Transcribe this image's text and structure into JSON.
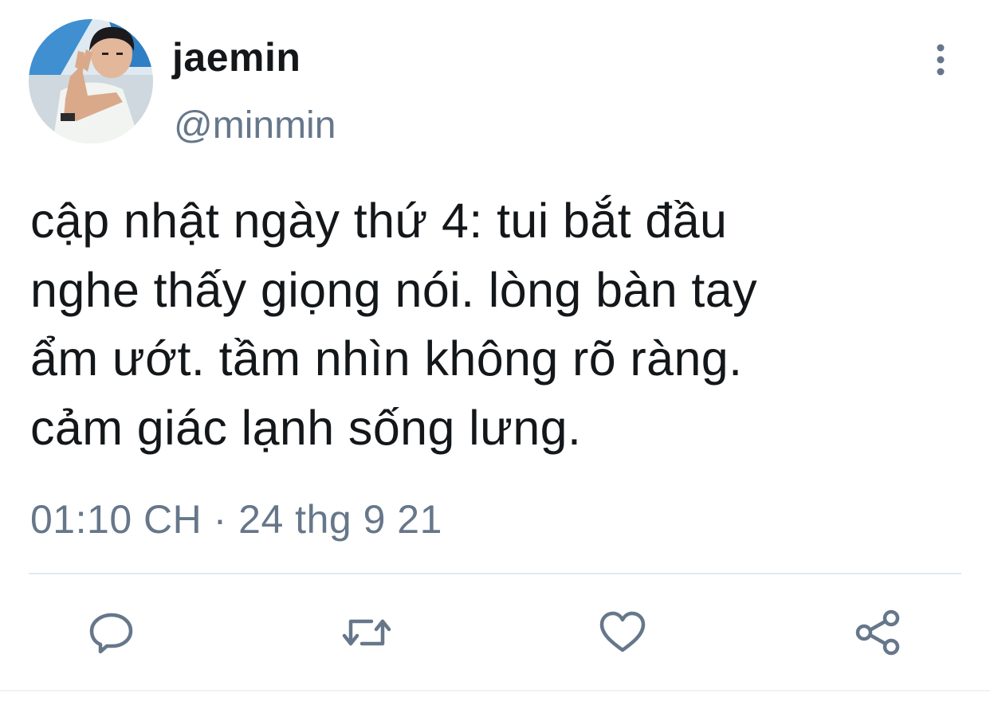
{
  "user": {
    "display_name": "jaemin",
    "handle": "@minmin",
    "avatar_icon": "profile-photo"
  },
  "tweet": {
    "text": "cập nhật ngày thứ 4: tui bắt đầu\nnghe thấy giọng nói. lòng bàn tay\nẩm ướt. tầm nhìn không rõ ràng.\ncảm giác lạnh sống lưng.",
    "timestamp": "01:10 CH · 24 thg 9 21"
  },
  "actions": {
    "reply_icon": "reply-icon",
    "retweet_icon": "retweet-icon",
    "like_icon": "heart-icon",
    "share_icon": "share-icon",
    "more_icon": "more-vertical-icon"
  },
  "colors": {
    "text": "#14171a",
    "secondary": "#66778a",
    "icon": "#66778a",
    "divider": "#e1e8ed"
  }
}
